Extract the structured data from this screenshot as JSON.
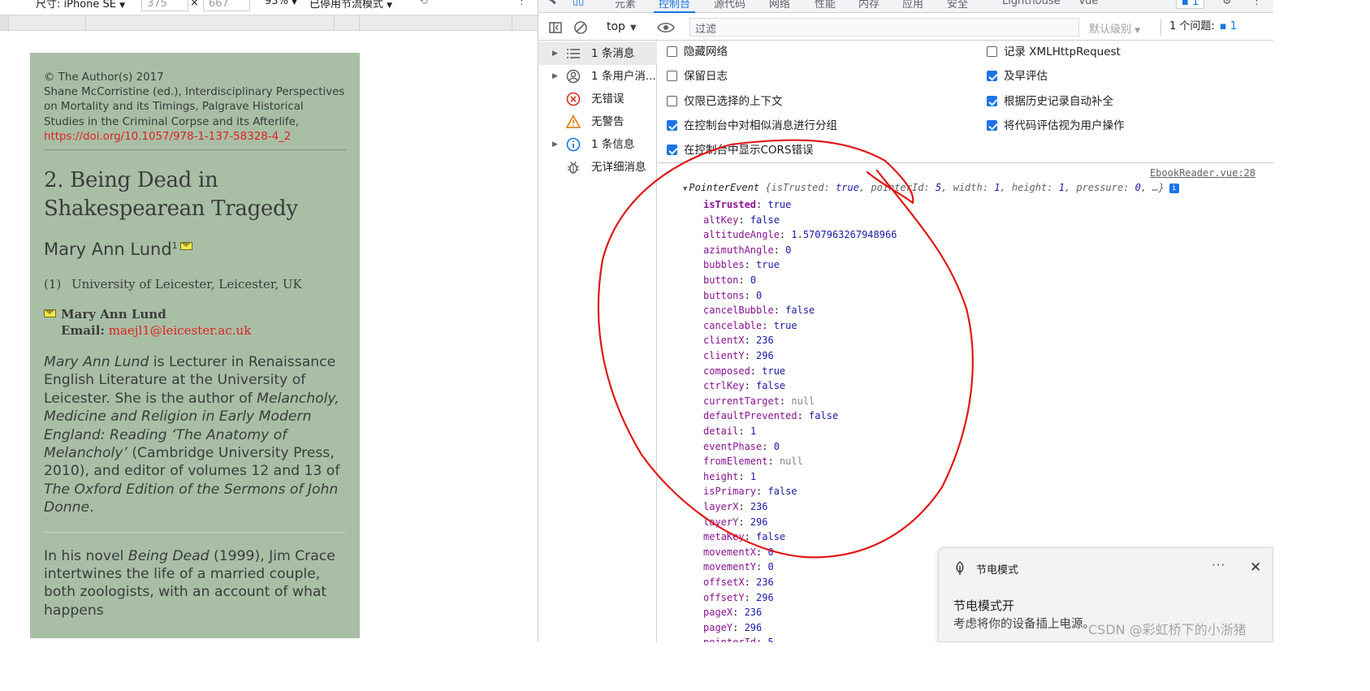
{
  "device_toolbar": {
    "device_label": "尺寸: iPhone SE",
    "width_value": "375",
    "times": "×",
    "height_value": "667",
    "zoom": "93%",
    "throttle": "已停用节流模式"
  },
  "page": {
    "copyright": "© The Author(s) 2017",
    "citation": "Shane McCorristine (ed.), Interdisciplinary Perspectives on Mortality and its Timings, Palgrave Historical Studies in the Criminal Corpse and its Afterlife,",
    "doi": "https://doi.org/10.1057/978-1-137-58328-4_2",
    "chapter_title_line1": "2. Being Dead in",
    "chapter_title_line2": "Shakespearean Tragedy",
    "author_name": "Mary Ann Lund",
    "author_sup": "1",
    "affil_num": "(1)",
    "affil_text": "University of Leicester, Leicester, UK",
    "contact_name": "Mary Ann Lund",
    "contact_email_label": "Email:",
    "contact_email": "maejl1@leicester.ac.uk",
    "bio": {
      "p1_italic": "Mary Ann Lund",
      "p1_text": " is Lecturer in Renaissance English Literature at the University of Leicester. She is the author of ",
      "p1_book_italic": "Melancholy, Medicine and Religion in Early Modern England: Reading ‘The Anatomy of Melancholy’",
      "p1_text2": " (Cambridge University Press, 2010), and editor of volumes 12 and 13 of ",
      "p1_series_italic": "The Oxford Edition of the Sermons of John Donne",
      "p1_end": "."
    },
    "para": {
      "a": "In his novel ",
      "b_italic": "Being Dead",
      "c": " (1999), Jim Crace intertwines the life of a married couple, both zoologists, with an account of what happens"
    }
  },
  "devtools": {
    "tabs": [
      {
        "label": "元素"
      },
      {
        "label": "控制台"
      },
      {
        "label": "源代码"
      },
      {
        "label": "网络"
      },
      {
        "label": "性能"
      },
      {
        "label": "内存"
      },
      {
        "label": "应用"
      },
      {
        "label": "安全"
      },
      {
        "label": "Lighthouse"
      },
      {
        "label": "Vue"
      }
    ],
    "tab_badge": "1",
    "context": "top",
    "filter_placeholder": "过滤",
    "levels": "默认级别",
    "issues_label": "1 个问题:",
    "issues_count": "1",
    "sidebar": [
      {
        "label": "1 条消息",
        "icon": "list-icon"
      },
      {
        "label": "1 条用户消...",
        "icon": "user-circle-icon"
      },
      {
        "label": "无错误",
        "icon": "error-icon"
      },
      {
        "label": "无警告",
        "icon": "warning-icon"
      },
      {
        "label": "1 条信息",
        "icon": "info-icon"
      },
      {
        "label": "无详细消息",
        "icon": "bug-icon"
      }
    ],
    "settings": {
      "left": [
        {
          "label": "隐藏网络",
          "checked": false
        },
        {
          "label": "保留日志",
          "checked": false
        },
        {
          "label": "仅限已选择的上下文",
          "checked": false
        },
        {
          "label": "在控制台中对相似消息进行分组",
          "checked": true
        },
        {
          "label": "在控制台中显示CORS错误",
          "checked": true
        }
      ],
      "right": [
        {
          "label": "记录 XMLHttpRequest",
          "checked": false
        },
        {
          "label": "及早评估",
          "checked": true
        },
        {
          "label": "根据历史记录自动补全",
          "checked": true
        },
        {
          "label": "将代码评估视为用户操作",
          "checked": true
        }
      ]
    },
    "log": {
      "source": "EbookReader.vue:28",
      "object_name": "PointerEvent",
      "preview_open": "{",
      "preview_pairs": [
        {
          "k": "isTrusted",
          "v": "true"
        },
        {
          "k": "pointerId",
          "v": "5"
        },
        {
          "k": "width",
          "v": "1"
        },
        {
          "k": "height",
          "v": "1"
        },
        {
          "k": "pressure",
          "v": "0"
        }
      ],
      "preview_tail": ", …}",
      "properties": [
        {
          "k": "isTrusted",
          "v": "true"
        },
        {
          "k": "altKey",
          "v": "false"
        },
        {
          "k": "altitudeAngle",
          "v": "1.5707963267948966"
        },
        {
          "k": "azimuthAngle",
          "v": "0"
        },
        {
          "k": "bubbles",
          "v": "true"
        },
        {
          "k": "button",
          "v": "0"
        },
        {
          "k": "buttons",
          "v": "0"
        },
        {
          "k": "cancelBubble",
          "v": "false"
        },
        {
          "k": "cancelable",
          "v": "true"
        },
        {
          "k": "clientX",
          "v": "236"
        },
        {
          "k": "clientY",
          "v": "296"
        },
        {
          "k": "composed",
          "v": "true"
        },
        {
          "k": "ctrlKey",
          "v": "false"
        },
        {
          "k": "currentTarget",
          "v": "null"
        },
        {
          "k": "defaultPrevented",
          "v": "false"
        },
        {
          "k": "detail",
          "v": "1"
        },
        {
          "k": "eventPhase",
          "v": "0"
        },
        {
          "k": "fromElement",
          "v": "null"
        },
        {
          "k": "height",
          "v": "1"
        },
        {
          "k": "isPrimary",
          "v": "false"
        },
        {
          "k": "layerX",
          "v": "236"
        },
        {
          "k": "layerY",
          "v": "296"
        },
        {
          "k": "metaKey",
          "v": "false"
        },
        {
          "k": "movementX",
          "v": "0"
        },
        {
          "k": "movementY",
          "v": "0"
        },
        {
          "k": "offsetX",
          "v": "236"
        },
        {
          "k": "offsetY",
          "v": "296"
        },
        {
          "k": "pageX",
          "v": "236"
        },
        {
          "k": "pageY",
          "v": "296"
        },
        {
          "k": "pointerId",
          "v": "5"
        }
      ]
    }
  },
  "toast": {
    "app_name": "节电模式",
    "more": "···",
    "close": "✕",
    "title": "节电模式开",
    "body": "考虑将你的设备插上电源。"
  },
  "watermark": "CSDN @彩虹桥下的小浙猪",
  "colors": {
    "page_bg": "#a8bfa6",
    "link_red": "#e02020",
    "accent_blue": "#1a73e8",
    "annotation_red": "#e01818"
  }
}
